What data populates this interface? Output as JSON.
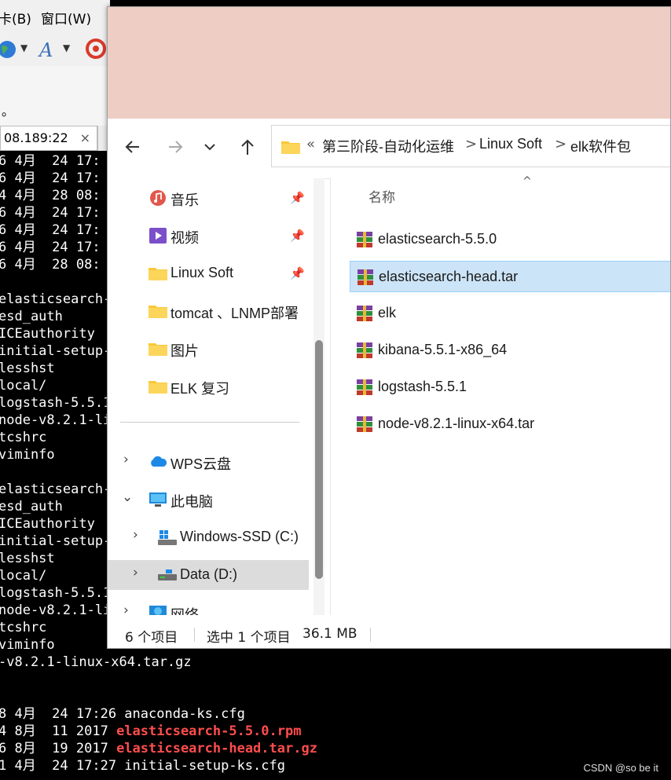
{
  "background_app": {
    "menu": [
      "卡(B)",
      "窗口(W)"
    ],
    "partial_text": "。",
    "tab_label": "08.189:22",
    "tab_close": "×",
    "terminal_lines": [
      {
        "text": "6 4月  24 17:",
        "red": false
      },
      {
        "text": "6 4月  24 17:",
        "red": false
      },
      {
        "text": "4 4月  28 08:",
        "red": false
      },
      {
        "text": "6 4月  24 17:",
        "red": false
      },
      {
        "text": "6 4月  24 17:",
        "red": false
      },
      {
        "text": "6 4月  24 17:",
        "red": false
      },
      {
        "text": "6 4月  28 08:",
        "red": false
      },
      {
        "text": "",
        "red": false
      },
      {
        "text": "elasticsearch-",
        "red": false
      },
      {
        "text": "esd_auth",
        "red": false
      },
      {
        "text": "ICEauthority",
        "red": false
      },
      {
        "text": "initial-setup-",
        "red": false
      },
      {
        "text": "lesshst",
        "red": false
      },
      {
        "text": "local/",
        "red": false
      },
      {
        "text": "logstash-5.5.1",
        "red": false
      },
      {
        "text": "node-v8.2.1-li",
        "red": false
      },
      {
        "text": "tcshrc",
        "red": false
      },
      {
        "text": "viminfo",
        "red": false
      },
      {
        "text": "",
        "red": false
      },
      {
        "text": "elasticsearch-",
        "red": false
      },
      {
        "text": "esd_auth",
        "red": false
      },
      {
        "text": "ICEauthority",
        "red": false
      },
      {
        "text": "initial-setup-",
        "red": false
      },
      {
        "text": "lesshst",
        "red": false
      },
      {
        "text": "local/",
        "red": false
      },
      {
        "text": "logstash-5.5.1",
        "red": false
      },
      {
        "text": "node-v8.2.1-li",
        "red": false
      },
      {
        "text": "tcshrc",
        "red": false
      },
      {
        "text": "viminfo",
        "red": false
      },
      {
        "text": "-v8.2.1-linux-x64.tar.gz",
        "red": false
      },
      {
        "text": "",
        "red": false
      },
      {
        "text": "",
        "red": false
      },
      {
        "text": "8 4月  24 17:26 anaconda-ks.cfg",
        "red": false
      },
      {
        "text": "4 8月  11 2017 ",
        "red": false,
        "tail": "elasticsearch-5.5.0.rpm"
      },
      {
        "text": "6 8月  19 2017 ",
        "red": false,
        "tail": "elasticsearch-head.tar.gz"
      },
      {
        "text": "1 4月  24 17:27 initial-setup-ks.cfg",
        "red": false
      }
    ]
  },
  "explorer": {
    "address": {
      "overflow": "«",
      "crumbs": [
        "第三阶段-自动化运维",
        "Linux Soft",
        "elk软件包"
      ],
      "separator": ">"
    },
    "nav": {
      "quick_access": [
        {
          "label": "音乐",
          "icon": "music-icon",
          "pinned": true
        },
        {
          "label": "视频",
          "icon": "video-icon",
          "pinned": true
        },
        {
          "label": "Linux Soft",
          "icon": "folder-icon",
          "pinned": true
        },
        {
          "label": "tomcat 、LNMP部署",
          "icon": "folder-icon",
          "pinned": false
        },
        {
          "label": "图片",
          "icon": "folder-icon",
          "pinned": false
        },
        {
          "label": "ELK 复习",
          "icon": "folder-icon",
          "pinned": false
        }
      ],
      "tree": [
        {
          "label": "WPS云盘",
          "icon": "cloud-icon",
          "chevron": ">",
          "level": 0
        },
        {
          "label": "此电脑",
          "icon": "computer-icon",
          "chevron": "v",
          "level": 0
        },
        {
          "label": "Windows-SSD (C:)",
          "icon": "windows-drive-icon",
          "chevron": ">",
          "level": 1
        },
        {
          "label": "Data (D:)",
          "icon": "drive-icon",
          "chevron": ">",
          "level": 1,
          "selected": true
        },
        {
          "label": "网络",
          "icon": "network-icon",
          "chevron": ">",
          "level": 0
        }
      ]
    },
    "content": {
      "column_name": "名称",
      "sort_indicator": "^",
      "files": [
        {
          "name": "elasticsearch-5.5.0",
          "icon": "archive-icon",
          "selected": false
        },
        {
          "name": "elasticsearch-head.tar",
          "icon": "archive-icon",
          "selected": true
        },
        {
          "name": "elk",
          "icon": "archive-icon",
          "selected": false
        },
        {
          "name": "kibana-5.5.1-x86_64",
          "icon": "archive-icon",
          "selected": false
        },
        {
          "name": "logstash-5.5.1",
          "icon": "archive-icon",
          "selected": false
        },
        {
          "name": "node-v8.2.1-linux-x64.tar",
          "icon": "archive-icon",
          "selected": false
        }
      ]
    },
    "status": {
      "item_count": "6 个项目",
      "selection": "选中 1 个项目",
      "size": "36.1 MB"
    }
  },
  "watermark": "CSDN @so be it",
  "colors": {
    "titlebar": "#eecdc5",
    "selection": "#cce4f7",
    "terminal_red": "#ff4d4d"
  }
}
